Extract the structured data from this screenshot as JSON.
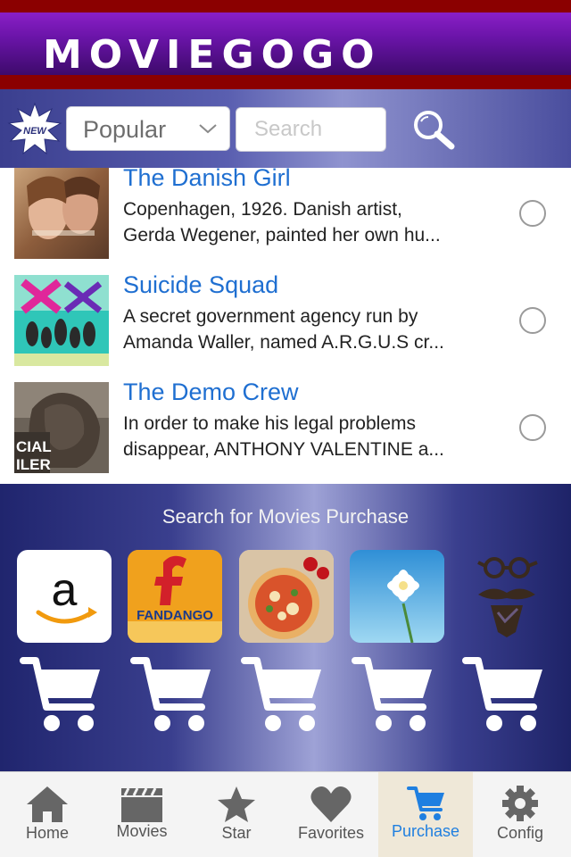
{
  "app": {
    "logo": "MOVIEGOGO"
  },
  "toolbar": {
    "badge_text": "NEW",
    "category_selected": "Popular",
    "search_placeholder": "Search"
  },
  "movies": [
    {
      "title": "The Danish Girl",
      "desc_line1": "Copenhagen, 1926. Danish artist,",
      "desc_line2": "Gerda Wegener, painted her own hu..."
    },
    {
      "title": "Suicide Squad",
      "desc_line1": "A secret government agency run by",
      "desc_line2": "Amanda Waller, named A.R.G.U.S cr..."
    },
    {
      "title": "The Demo Crew",
      "desc_line1": "In order to make his legal problems",
      "desc_line2": "disappear, ANTHONY VALENTINE a...",
      "thumb_text_1": "CIAL",
      "thumb_text_2": "ILER"
    }
  ],
  "purchase": {
    "title": "Search for Movies Purchase",
    "fandango_text": "FANDANGO"
  },
  "tabs": [
    {
      "label": "Home",
      "icon": "house-icon"
    },
    {
      "label": "Movies",
      "icon": "clapperboard-icon"
    },
    {
      "label": "Star",
      "icon": "star-icon"
    },
    {
      "label": "Favorites",
      "icon": "heart-icon"
    },
    {
      "label": "Purchase",
      "icon": "cart-icon",
      "active": true
    },
    {
      "label": "Config",
      "icon": "gear-icon"
    }
  ],
  "colors": {
    "link_blue": "#1f6fd1",
    "active_tab": "#1f7fe0",
    "header_purple": "#6a14a8",
    "header_red": "#8b0000"
  }
}
